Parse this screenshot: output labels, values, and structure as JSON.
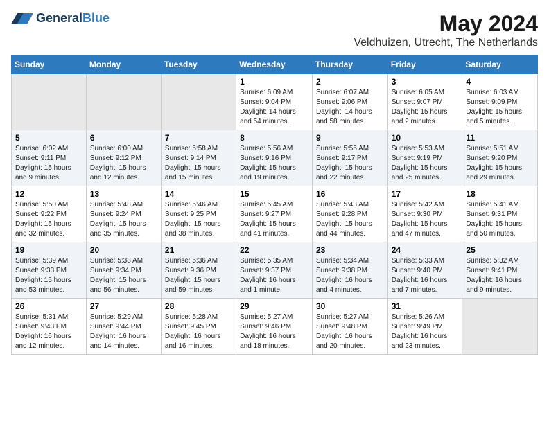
{
  "logo": {
    "general": "General",
    "blue": "Blue"
  },
  "title": "May 2024",
  "subtitle": "Veldhuizen, Utrecht, The Netherlands",
  "days_of_week": [
    "Sunday",
    "Monday",
    "Tuesday",
    "Wednesday",
    "Thursday",
    "Friday",
    "Saturday"
  ],
  "weeks": [
    [
      {
        "day": "",
        "info": ""
      },
      {
        "day": "",
        "info": ""
      },
      {
        "day": "",
        "info": ""
      },
      {
        "day": "1",
        "info": "Sunrise: 6:09 AM\nSunset: 9:04 PM\nDaylight: 14 hours and 54 minutes."
      },
      {
        "day": "2",
        "info": "Sunrise: 6:07 AM\nSunset: 9:06 PM\nDaylight: 14 hours and 58 minutes."
      },
      {
        "day": "3",
        "info": "Sunrise: 6:05 AM\nSunset: 9:07 PM\nDaylight: 15 hours and 2 minutes."
      },
      {
        "day": "4",
        "info": "Sunrise: 6:03 AM\nSunset: 9:09 PM\nDaylight: 15 hours and 5 minutes."
      }
    ],
    [
      {
        "day": "5",
        "info": "Sunrise: 6:02 AM\nSunset: 9:11 PM\nDaylight: 15 hours and 9 minutes."
      },
      {
        "day": "6",
        "info": "Sunrise: 6:00 AM\nSunset: 9:12 PM\nDaylight: 15 hours and 12 minutes."
      },
      {
        "day": "7",
        "info": "Sunrise: 5:58 AM\nSunset: 9:14 PM\nDaylight: 15 hours and 15 minutes."
      },
      {
        "day": "8",
        "info": "Sunrise: 5:56 AM\nSunset: 9:16 PM\nDaylight: 15 hours and 19 minutes."
      },
      {
        "day": "9",
        "info": "Sunrise: 5:55 AM\nSunset: 9:17 PM\nDaylight: 15 hours and 22 minutes."
      },
      {
        "day": "10",
        "info": "Sunrise: 5:53 AM\nSunset: 9:19 PM\nDaylight: 15 hours and 25 minutes."
      },
      {
        "day": "11",
        "info": "Sunrise: 5:51 AM\nSunset: 9:20 PM\nDaylight: 15 hours and 29 minutes."
      }
    ],
    [
      {
        "day": "12",
        "info": "Sunrise: 5:50 AM\nSunset: 9:22 PM\nDaylight: 15 hours and 32 minutes."
      },
      {
        "day": "13",
        "info": "Sunrise: 5:48 AM\nSunset: 9:24 PM\nDaylight: 15 hours and 35 minutes."
      },
      {
        "day": "14",
        "info": "Sunrise: 5:46 AM\nSunset: 9:25 PM\nDaylight: 15 hours and 38 minutes."
      },
      {
        "day": "15",
        "info": "Sunrise: 5:45 AM\nSunset: 9:27 PM\nDaylight: 15 hours and 41 minutes."
      },
      {
        "day": "16",
        "info": "Sunrise: 5:43 AM\nSunset: 9:28 PM\nDaylight: 15 hours and 44 minutes."
      },
      {
        "day": "17",
        "info": "Sunrise: 5:42 AM\nSunset: 9:30 PM\nDaylight: 15 hours and 47 minutes."
      },
      {
        "day": "18",
        "info": "Sunrise: 5:41 AM\nSunset: 9:31 PM\nDaylight: 15 hours and 50 minutes."
      }
    ],
    [
      {
        "day": "19",
        "info": "Sunrise: 5:39 AM\nSunset: 9:33 PM\nDaylight: 15 hours and 53 minutes."
      },
      {
        "day": "20",
        "info": "Sunrise: 5:38 AM\nSunset: 9:34 PM\nDaylight: 15 hours and 56 minutes."
      },
      {
        "day": "21",
        "info": "Sunrise: 5:36 AM\nSunset: 9:36 PM\nDaylight: 15 hours and 59 minutes."
      },
      {
        "day": "22",
        "info": "Sunrise: 5:35 AM\nSunset: 9:37 PM\nDaylight: 16 hours and 1 minute."
      },
      {
        "day": "23",
        "info": "Sunrise: 5:34 AM\nSunset: 9:38 PM\nDaylight: 16 hours and 4 minutes."
      },
      {
        "day": "24",
        "info": "Sunrise: 5:33 AM\nSunset: 9:40 PM\nDaylight: 16 hours and 7 minutes."
      },
      {
        "day": "25",
        "info": "Sunrise: 5:32 AM\nSunset: 9:41 PM\nDaylight: 16 hours and 9 minutes."
      }
    ],
    [
      {
        "day": "26",
        "info": "Sunrise: 5:31 AM\nSunset: 9:43 PM\nDaylight: 16 hours and 12 minutes."
      },
      {
        "day": "27",
        "info": "Sunrise: 5:29 AM\nSunset: 9:44 PM\nDaylight: 16 hours and 14 minutes."
      },
      {
        "day": "28",
        "info": "Sunrise: 5:28 AM\nSunset: 9:45 PM\nDaylight: 16 hours and 16 minutes."
      },
      {
        "day": "29",
        "info": "Sunrise: 5:27 AM\nSunset: 9:46 PM\nDaylight: 16 hours and 18 minutes."
      },
      {
        "day": "30",
        "info": "Sunrise: 5:27 AM\nSunset: 9:48 PM\nDaylight: 16 hours and 20 minutes."
      },
      {
        "day": "31",
        "info": "Sunrise: 5:26 AM\nSunset: 9:49 PM\nDaylight: 16 hours and 23 minutes."
      },
      {
        "day": "",
        "info": ""
      }
    ]
  ]
}
